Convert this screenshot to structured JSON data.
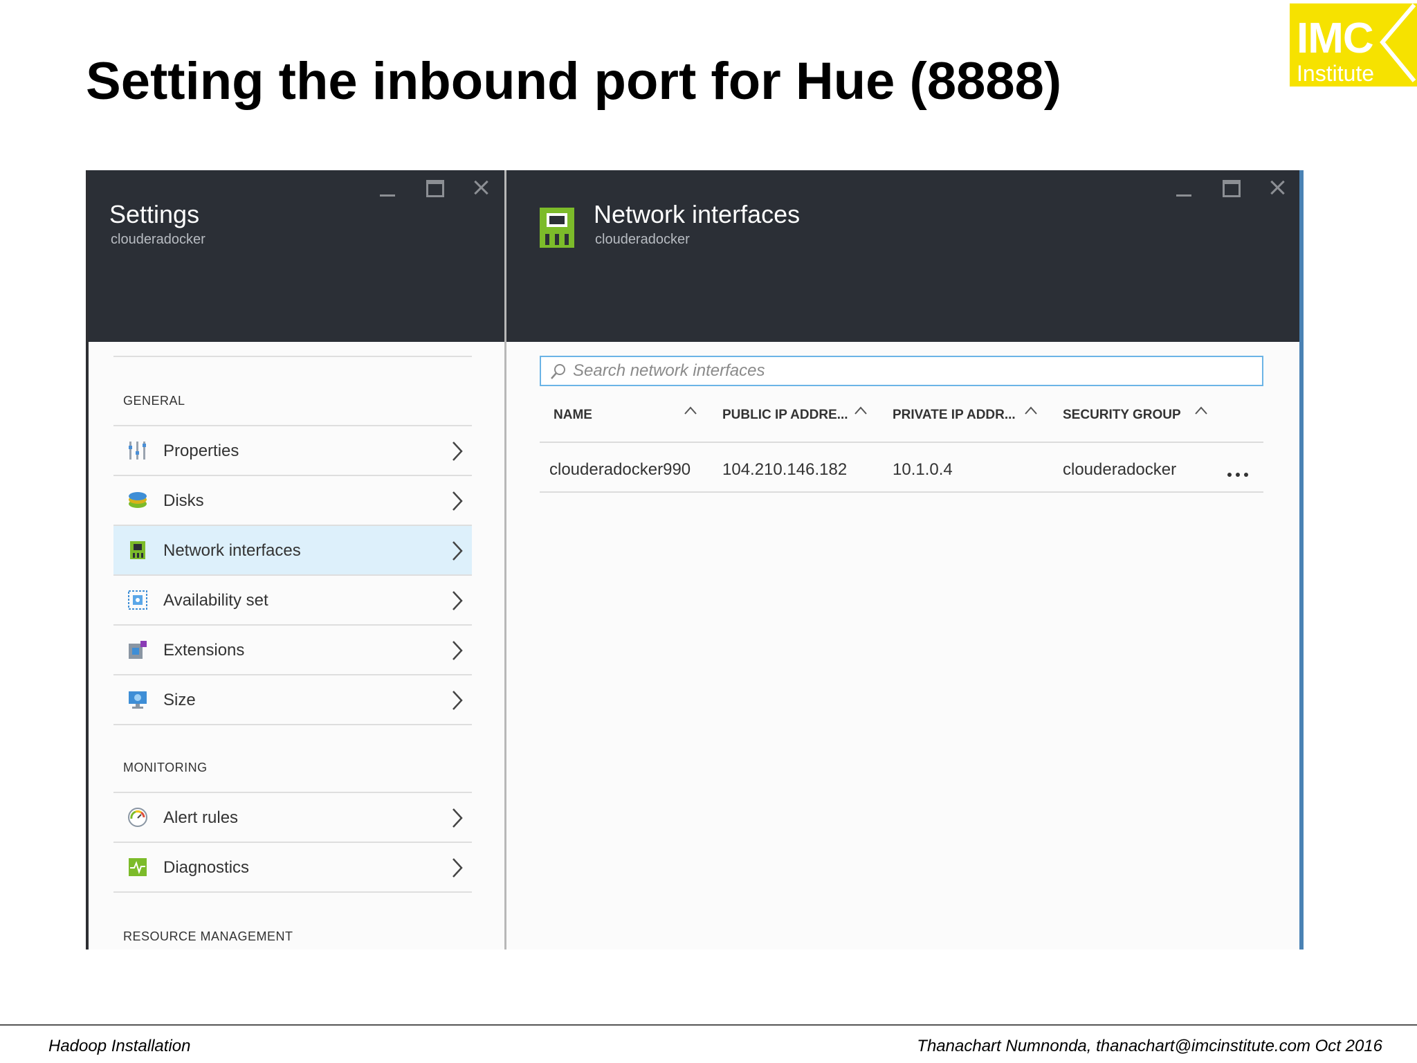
{
  "slide": {
    "title": "Setting the inbound port for Hue (8888)",
    "logo": {
      "main": "IMC",
      "sub": "Institute",
      "color": "#f6e200"
    },
    "footer": {
      "left": "Hadoop Installation",
      "right": "Thanachart Numnonda,  thanachart@imcinstitute.com  Oct 2016"
    }
  },
  "settings_blade": {
    "title": "Settings",
    "subtitle": "clouderadocker",
    "window_controls": [
      "minimize-icon",
      "maximize-icon",
      "close-icon"
    ],
    "sections": [
      {
        "label": "GENERAL",
        "items": [
          {
            "label": "Properties",
            "icon": "properties-icon",
            "selected": false
          },
          {
            "label": "Disks",
            "icon": "disks-icon",
            "selected": false
          },
          {
            "label": "Network interfaces",
            "icon": "network-interface-icon",
            "selected": true
          },
          {
            "label": "Availability set",
            "icon": "availability-set-icon",
            "selected": false
          },
          {
            "label": "Extensions",
            "icon": "extensions-icon",
            "selected": false
          },
          {
            "label": "Size",
            "icon": "size-icon",
            "selected": false
          }
        ]
      },
      {
        "label": "MONITORING",
        "items": [
          {
            "label": "Alert rules",
            "icon": "alert-rules-icon",
            "selected": false
          },
          {
            "label": "Diagnostics",
            "icon": "diagnostics-icon",
            "selected": false
          }
        ]
      },
      {
        "label": "RESOURCE MANAGEMENT",
        "items": []
      }
    ]
  },
  "network_blade": {
    "title": "Network interfaces",
    "subtitle": "clouderadocker",
    "icon": "network-interface-icon",
    "window_controls": [
      "minimize-icon",
      "maximize-icon",
      "close-icon"
    ],
    "search": {
      "placeholder": "Search network interfaces",
      "value": ""
    },
    "table": {
      "columns": [
        "NAME",
        "PUBLIC IP ADDRE...",
        "PRIVATE IP ADDR...",
        "SECURITY GROUP"
      ],
      "rows": [
        [
          "clouderadocker990",
          "104.210.146.182",
          "10.1.0.4",
          "clouderadocker"
        ]
      ]
    }
  },
  "colors": {
    "header_bg": "#2b2f36",
    "selected_row": "#ddf0fb",
    "search_border": "#6bb4e6",
    "blade_accent": "#4a82b4"
  }
}
